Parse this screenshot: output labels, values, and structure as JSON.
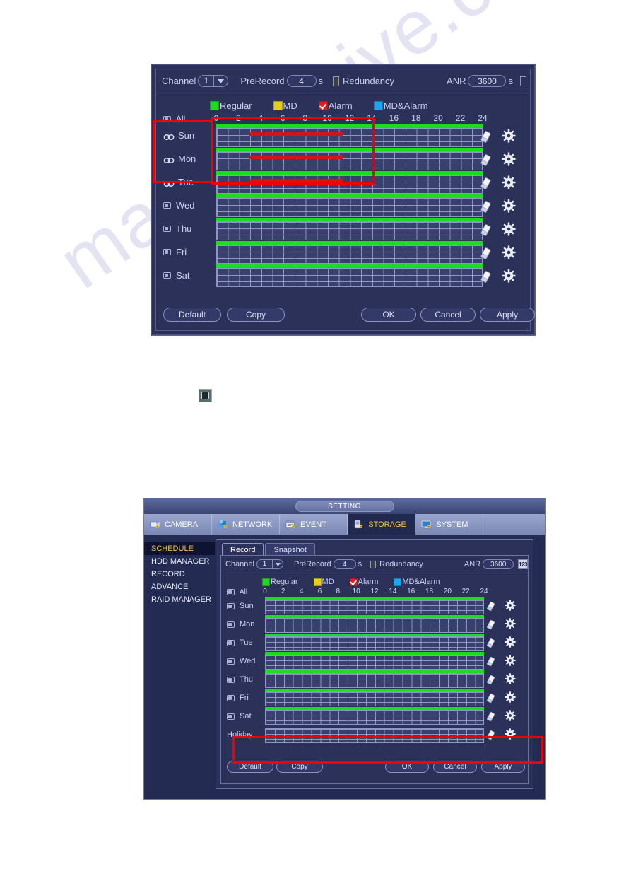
{
  "watermark": "manualshive.com",
  "figure1": {
    "toolbar": {
      "channel_label": "Channel",
      "channel_value": "1",
      "prerecord_label": "PreRecord",
      "prerecord_value": "4",
      "prerecord_unit": "s",
      "redundancy_label": "Redundancy",
      "anr_label": "ANR",
      "anr_value": "3600",
      "anr_unit": "s"
    },
    "legend": [
      {
        "label": "Regular",
        "color": "#1ddb1d",
        "checked": false
      },
      {
        "label": "MD",
        "color": "#e3cf18",
        "checked": false
      },
      {
        "label": "Alarm",
        "color": "#e02020",
        "checked": true
      },
      {
        "label": "MD&Alarm",
        "color": "#1aa7f0",
        "checked": false
      }
    ],
    "all_label": "All",
    "ticks": [
      "0",
      "2",
      "4",
      "6",
      "8",
      "10",
      "12",
      "14",
      "16",
      "18",
      "20",
      "22",
      "24"
    ],
    "rows": [
      {
        "day": "Sun",
        "selector": "link",
        "regular_start": 0,
        "regular_end": 24,
        "alarm_start": 3,
        "alarm_end": 11.4
      },
      {
        "day": "Mon",
        "selector": "link",
        "regular_start": 0,
        "regular_end": 24,
        "alarm_start": 3,
        "alarm_end": 11.4
      },
      {
        "day": "Tue",
        "selector": "link",
        "regular_start": 0,
        "regular_end": 24,
        "alarm_start": 3,
        "alarm_end": 11.4
      },
      {
        "day": "Wed",
        "selector": "check",
        "regular_start": 0,
        "regular_end": 24,
        "alarm_start": null,
        "alarm_end": null
      },
      {
        "day": "Thu",
        "selector": "check",
        "regular_start": 0,
        "regular_end": 24,
        "alarm_start": null,
        "alarm_end": null
      },
      {
        "day": "Fri",
        "selector": "check",
        "regular_start": 0,
        "regular_end": 24,
        "alarm_start": null,
        "alarm_end": null
      },
      {
        "day": "Sat",
        "selector": "check",
        "regular_start": 0,
        "regular_end": 24,
        "alarm_start": null,
        "alarm_end": null
      }
    ],
    "buttons": {
      "default": "Default",
      "copy": "Copy",
      "ok": "OK",
      "cancel": "Cancel",
      "apply": "Apply"
    }
  },
  "figure2": {
    "window_title": "SETTING",
    "tabs": [
      {
        "label": "CAMERA",
        "icon": "camera-icon",
        "active": false
      },
      {
        "label": "NETWORK",
        "icon": "network-icon",
        "active": false
      },
      {
        "label": "EVENT",
        "icon": "event-icon",
        "active": false
      },
      {
        "label": "STORAGE",
        "icon": "storage-icon",
        "active": true
      },
      {
        "label": "SYSTEM",
        "icon": "system-icon",
        "active": false
      }
    ],
    "sidebar": [
      {
        "label": "SCHEDULE",
        "active": true
      },
      {
        "label": "HDD MANAGER",
        "active": false
      },
      {
        "label": "RECORD",
        "active": false
      },
      {
        "label": "ADVANCE",
        "active": false
      },
      {
        "label": "RAID MANAGER",
        "active": false
      }
    ],
    "subtabs": [
      {
        "label": "Record",
        "active": true
      },
      {
        "label": "Snapshot",
        "active": false
      }
    ],
    "toolbar": {
      "channel_label": "Channel",
      "channel_value": "1",
      "prerecord_label": "PreRecord",
      "prerecord_value": "4",
      "prerecord_unit": "s",
      "redundancy_label": "Redundancy",
      "anr_label": "ANR",
      "anr_value": "3600",
      "anr_keypad": "123"
    },
    "legend": [
      {
        "label": "Regular",
        "color": "#1ddb1d",
        "checked": false
      },
      {
        "label": "MD",
        "color": "#e3cf18",
        "checked": false
      },
      {
        "label": "Alarm",
        "color": "#e02020",
        "checked": true
      },
      {
        "label": "MD&Alarm",
        "color": "#1aa7f0",
        "checked": false
      }
    ],
    "all_label": "All",
    "ticks": [
      "0",
      "2",
      "4",
      "6",
      "8",
      "10",
      "12",
      "14",
      "16",
      "18",
      "20",
      "22",
      "24"
    ],
    "rows": [
      {
        "day": "Sun",
        "selector": "check",
        "regular_start": 0,
        "regular_end": 24
      },
      {
        "day": "Mon",
        "selector": "check",
        "regular_start": 0,
        "regular_end": 24
      },
      {
        "day": "Tue",
        "selector": "check",
        "regular_start": 0,
        "regular_end": 24
      },
      {
        "day": "Wed",
        "selector": "check",
        "regular_start": 0,
        "regular_end": 24
      },
      {
        "day": "Thu",
        "selector": "check",
        "regular_start": 0,
        "regular_end": 24
      },
      {
        "day": "Fri",
        "selector": "check",
        "regular_start": 0,
        "regular_end": 24
      },
      {
        "day": "Sat",
        "selector": "check",
        "regular_start": 0,
        "regular_end": 24
      },
      {
        "day": "Holiday",
        "selector": "none",
        "regular_start": null,
        "regular_end": null
      }
    ],
    "buttons": {
      "default": "Default",
      "copy": "Copy",
      "ok": "OK",
      "cancel": "Cancel",
      "apply": "Apply"
    }
  },
  "inline_icon": {
    "name": "record-square-icon"
  },
  "annotations": {
    "accent_color": "#ee0000",
    "figure1_box_days": "Sun/Mon/Tue link selectors",
    "figure1_box_range": "alarm period 0-14h region",
    "figure2_box_holiday": "Holiday row"
  }
}
